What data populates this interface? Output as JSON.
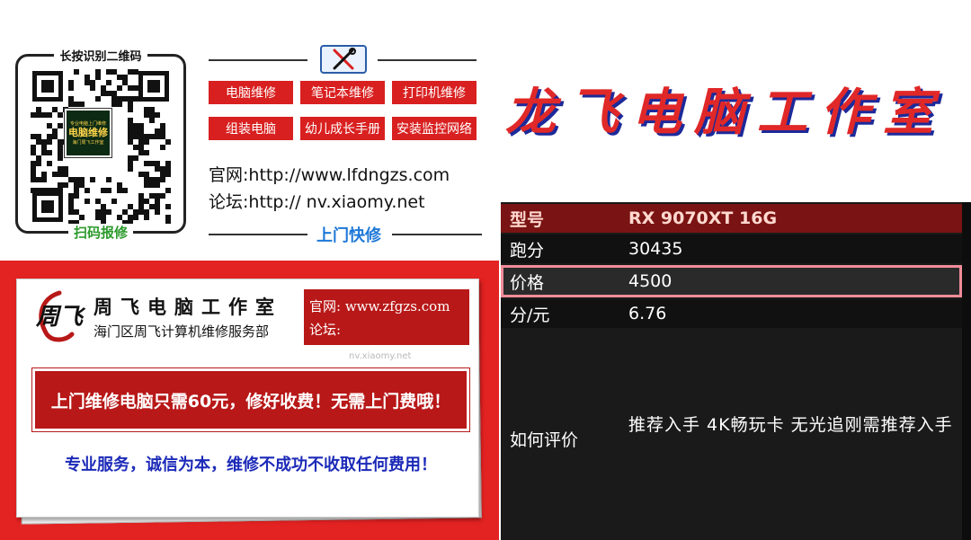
{
  "qr_card": {
    "title": "长按识别二维码",
    "center_small_top": "专业电脑上门维修",
    "center_main": "电脑维修",
    "center_small_bottom": "海门周飞工作室",
    "bottom_label": "扫码报修"
  },
  "services": {
    "buttons": [
      "电脑维修",
      "笔记本维修",
      "打印机维修",
      "组装电脑",
      "幼儿成长手册",
      "安装监控网络"
    ],
    "site_label": "官网:",
    "site_value": "http://www.lfdngzs.com",
    "forum_label": "论坛:",
    "forum_value": "http:// nv.xiaomy.net",
    "visit_label": "上门快修"
  },
  "big_title": "龙飞电脑工作室",
  "banner": {
    "logo": "周飞",
    "shop_title": "周飞电脑工作室",
    "shop_sub": "海门区周飞计算机维修服务部",
    "site_label": "官网:",
    "site_value": "www.zfgzs.com",
    "forum_label": "论坛:",
    "ghost_text": "nv.xiaomy.net",
    "promo_main": "上门维修电脑只需60元，修好收费！无需上门费哦！",
    "promo_sub": "专业服务，诚信为本，维修不成功不收取任何费用！"
  },
  "spec": {
    "rows": [
      {
        "key": "型号",
        "value": "RX 9070XT 16G"
      },
      {
        "key": "跑分",
        "value": "30435"
      },
      {
        "key": "价格",
        "value": "4500"
      },
      {
        "key": "分/元",
        "value": "6.76"
      }
    ],
    "eval_key": "如何评价",
    "eval_value": "推荐入手 4K畅玩卡 无光追刚需推荐入手"
  },
  "colors": {
    "red": "#e32222",
    "dark_red": "#b81818",
    "blue": "#1c2ab8",
    "green": "#2b9a2b"
  }
}
